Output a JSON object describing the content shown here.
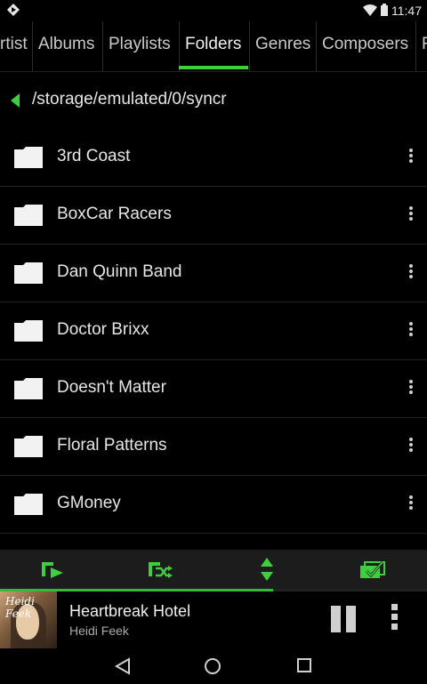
{
  "status_bar": {
    "time": "11:47"
  },
  "tabs": [
    {
      "label": "rtist"
    },
    {
      "label": "Albums"
    },
    {
      "label": "Playlists"
    },
    {
      "label": "Folders",
      "active": true
    },
    {
      "label": "Genres"
    },
    {
      "label": "Composers"
    },
    {
      "label": "F"
    }
  ],
  "path": {
    "text": "/storage/emulated/0/syncr"
  },
  "folders": [
    {
      "name": "3rd Coast"
    },
    {
      "name": "BoxCar Racers"
    },
    {
      "name": "Dan Quinn Band"
    },
    {
      "name": "Doctor Brixx"
    },
    {
      "name": "Doesn't Matter"
    },
    {
      "name": "Floral Patterns"
    },
    {
      "name": "GMoney"
    }
  ],
  "action_bar": {
    "buttons": [
      "play-queue-icon",
      "shuffle-queue-icon",
      "sort-icon",
      "multi-select-icon"
    ]
  },
  "playback": {
    "progress": 0.64
  },
  "now_playing": {
    "title": "Heartbreak Hotel",
    "artist": "Heidi Feek",
    "album_art_text": "Heidi Feek"
  },
  "colors": {
    "accent": "#3dcf3d",
    "background": "#000000",
    "action_bar": "#1c1c1c"
  }
}
